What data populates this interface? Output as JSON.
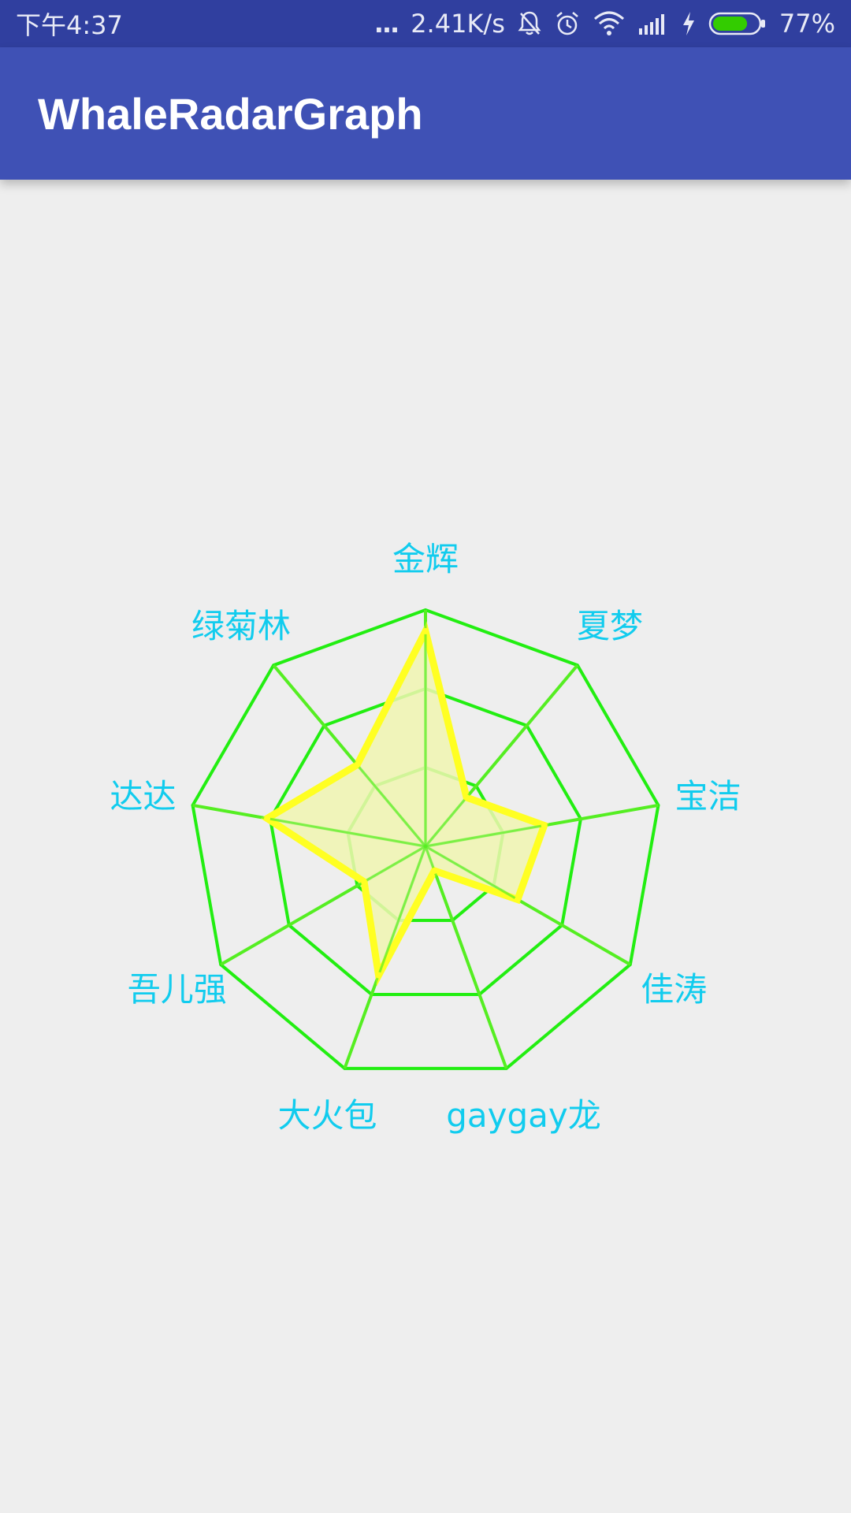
{
  "status_bar": {
    "time": "下午4:37",
    "more": "...",
    "speed": "2.41K/s",
    "battery_percent": "77%",
    "battery_level": 0.77,
    "icons": [
      "notifications-off-icon",
      "alarm-icon",
      "wifi-icon",
      "signal-icon",
      "charging-icon",
      "battery-icon"
    ]
  },
  "app_bar": {
    "title": "WhaleRadarGraph"
  },
  "chart_data": {
    "type": "radar",
    "categories": [
      "金辉",
      "夏梦",
      "宝洁",
      "佳涛",
      "gaygay龙",
      "大火包",
      "吾儿强",
      "达达",
      "绿菊林"
    ],
    "values": [
      0.91,
      0.27,
      0.51,
      0.45,
      0.11,
      0.58,
      0.3,
      0.68,
      0.45
    ],
    "levels": 3,
    "max": 1,
    "colors": {
      "grid": "#22ee11",
      "spokes": "#55ee22",
      "series_stroke": "#ffff22",
      "series_fill": "#f0f5b0",
      "labels": "#11ccee"
    }
  }
}
